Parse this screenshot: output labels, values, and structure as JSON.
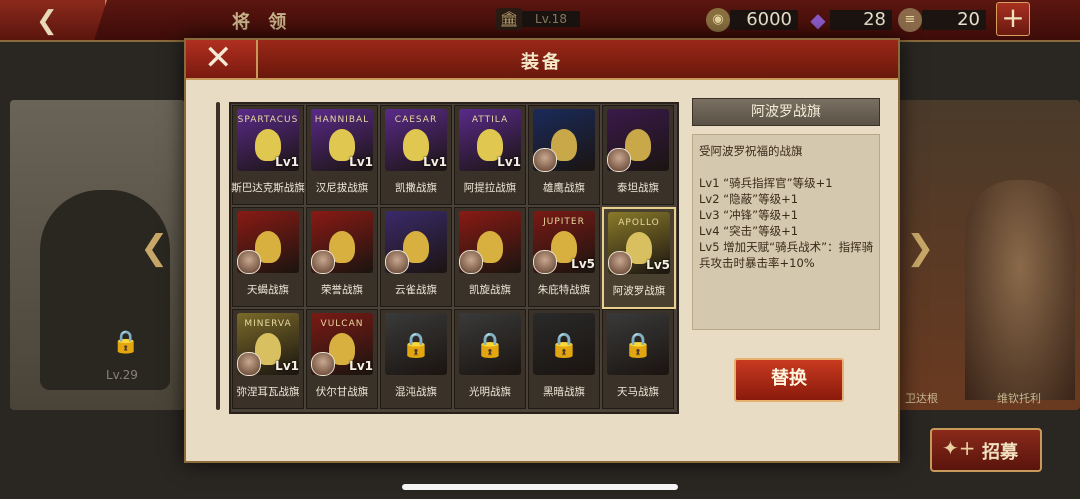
{
  "topbar": {
    "title": "将 领",
    "level": "Lv.18",
    "gold": "6000",
    "gems": "28",
    "food": "20",
    "back_icon": "back-arrow-icon",
    "plus_icon": "plus-icon"
  },
  "background": {
    "left_level": "Lv.29",
    "right_name_1": "卫达根",
    "right_name_2": "维钦托利",
    "recruit_label": "招募"
  },
  "modal": {
    "title": "装备",
    "close_icon": "close-icon",
    "banners": [
      {
        "name": "斯巴达克斯战旗",
        "mark": "SPARTACUS",
        "level": "Lv1",
        "color": "#5a2a8a",
        "emblem": "#e0c850",
        "locked": false,
        "portrait": false
      },
      {
        "name": "汉尼拔战旗",
        "mark": "HANNIBAL",
        "level": "Lv1",
        "color": "#5a2a8a",
        "emblem": "#e0c850",
        "locked": false,
        "portrait": false
      },
      {
        "name": "凯撒战旗",
        "mark": "CAESAR",
        "level": "Lv1",
        "color": "#5a2a8a",
        "emblem": "#e0c850",
        "locked": false,
        "portrait": false
      },
      {
        "name": "阿提拉战旗",
        "mark": "ATTILA",
        "level": "Lv1",
        "color": "#5a2a8a",
        "emblem": "#e0c850",
        "locked": false,
        "portrait": false
      },
      {
        "name": "雄鹰战旗",
        "mark": "",
        "level": "",
        "color": "#1a2a5a",
        "emblem": "#c8a848",
        "locked": false,
        "portrait": true
      },
      {
        "name": "泰坦战旗",
        "mark": "",
        "level": "",
        "color": "#3a1a4a",
        "emblem": "#c8a848",
        "locked": false,
        "portrait": true
      },
      {
        "name": "天蝎战旗",
        "mark": "",
        "level": "",
        "color": "#8a1a14",
        "emblem": "#d8b040",
        "locked": false,
        "portrait": true
      },
      {
        "name": "荣誉战旗",
        "mark": "",
        "level": "",
        "color": "#8a1a14",
        "emblem": "#d8b040",
        "locked": false,
        "portrait": true
      },
      {
        "name": "云雀战旗",
        "mark": "",
        "level": "",
        "color": "#3a2a6a",
        "emblem": "#d8b040",
        "locked": false,
        "portrait": true
      },
      {
        "name": "凯旋战旗",
        "mark": "",
        "level": "",
        "color": "#8a1a14",
        "emblem": "#d8b040",
        "locked": false,
        "portrait": true
      },
      {
        "name": "朱庇特战旗",
        "mark": "JUPITER",
        "level": "Lv5",
        "color": "#7a1a14",
        "emblem": "#d8b040",
        "locked": false,
        "portrait": true
      },
      {
        "name": "阿波罗战旗",
        "mark": "APOLLO",
        "level": "Lv5",
        "color": "#8a7a2a",
        "emblem": "#d8c060",
        "locked": false,
        "portrait": true
      },
      {
        "name": "弥涅耳瓦战旗",
        "mark": "MINERVA",
        "level": "Lv1",
        "color": "#7a6a2a",
        "emblem": "#d8c060",
        "locked": false,
        "portrait": true
      },
      {
        "name": "伏尔甘战旗",
        "mark": "VULCAN",
        "level": "Lv1",
        "color": "#7a1a14",
        "emblem": "#d8b040",
        "locked": false,
        "portrait": true
      },
      {
        "name": "混沌战旗",
        "mark": "",
        "level": "",
        "color": "#3a3a3a",
        "emblem": "#8a8a8a",
        "locked": true,
        "portrait": false
      },
      {
        "name": "光明战旗",
        "mark": "",
        "level": "",
        "color": "#3a3a3a",
        "emblem": "#8a8a8a",
        "locked": true,
        "portrait": false
      },
      {
        "name": "黑暗战旗",
        "mark": "",
        "level": "",
        "color": "#2a2a2a",
        "emblem": "#8a8a8a",
        "locked": true,
        "portrait": false
      },
      {
        "name": "天马战旗",
        "mark": "",
        "level": "",
        "color": "#3a3a3a",
        "emblem": "#8a8a8a",
        "locked": true,
        "portrait": false
      }
    ],
    "selected_index": 11,
    "detail": {
      "title": "阿波罗战旗",
      "description": "受阿波罗祝福的战旗",
      "effects": [
        "Lv1 “骑兵指挥官”等级+1",
        "Lv2 “隐蔽”等级+1",
        "Lv3 “冲锋”等级+1",
        "Lv4 “突击”等级+1",
        "Lv5 增加天赋“骑兵战术”：指挥骑兵攻击时暴击率+10%"
      ]
    },
    "replace_label": "替换"
  },
  "colors": {
    "header_red": "#9a2818",
    "panel_parchment": "#e8dcc4",
    "selected_border": "#e8d090"
  }
}
